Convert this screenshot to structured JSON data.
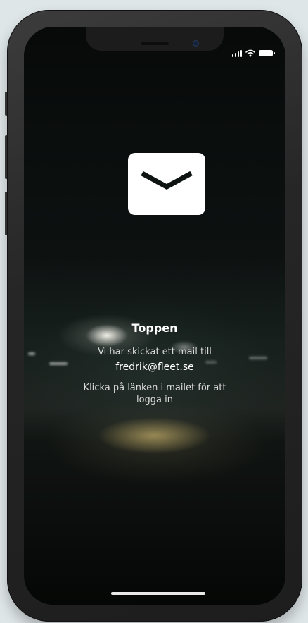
{
  "status_bar": {
    "signal_icon": "cellular-signal-icon",
    "wifi_icon": "wifi-icon",
    "battery_icon": "battery-icon"
  },
  "hero": {
    "icon": "envelope-icon"
  },
  "message": {
    "title": "Toppen",
    "line1": "Vi har skickat ett mail till",
    "email": "fredrik@fleet.se",
    "line3": "Klicka på länken i mailet för att logga in"
  },
  "colors": {
    "phone_frame": "#262626",
    "screen_background": "#0a0d0c",
    "text": "#ffffff",
    "icon_fill": "#ffffff",
    "icon_stroke": "#0d1411"
  }
}
